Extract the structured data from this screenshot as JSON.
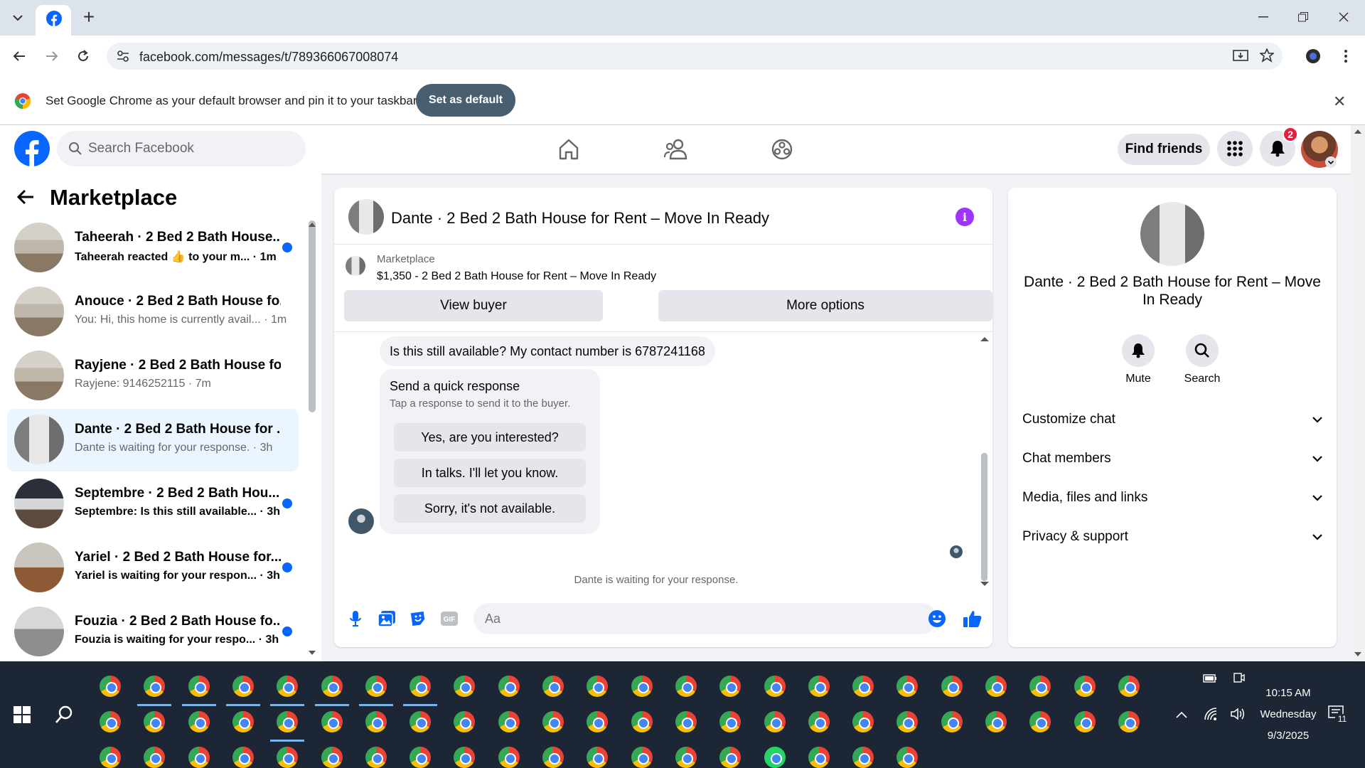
{
  "browser": {
    "url": "facebook.com/messages/t/789366067008074",
    "infobar_text": "Set Google Chrome as your default browser and pin it to your taskbar",
    "infobar_button": "Set as default"
  },
  "header": {
    "search_placeholder": "Search Facebook",
    "find_friends": "Find friends",
    "notification_count": "2"
  },
  "sidebar": {
    "title": "Marketplace",
    "conversations": [
      {
        "title": "Taheerah · 2 Bed 2 Bath House...",
        "subtitle": "Taheerah reacted 👍 to your m... · 1m",
        "unread": true,
        "thumb": "t-room"
      },
      {
        "title": "Anouce · 2 Bed 2 Bath House fo...",
        "subtitle": "You: Hi, this home is currently avail... · 1m",
        "unread": false,
        "thumb": "t-room"
      },
      {
        "title": "Rayjene · 2 Bed 2 Bath House fo...",
        "subtitle": "Rayjene: 9146252115 · 7m",
        "unread": false,
        "thumb": "t-room"
      },
      {
        "title": "Dante · 2 Bed 2 Bath House for ...",
        "subtitle": "Dante is waiting for your response. · 3h",
        "unread": false,
        "selected": true,
        "thumb": "t-hall"
      },
      {
        "title": "Septembre · 2 Bed 2 Bath Hou...",
        "subtitle": "Septembre: Is this still available... · 3h",
        "unread": true,
        "thumb": "t-dark"
      },
      {
        "title": "Yariel · 2 Bed 2 Bath House for...",
        "subtitle": "Yariel is waiting for your respon... · 3h",
        "unread": true,
        "thumb": "t-wood"
      },
      {
        "title": "Fouzia · 2 Bed 2 Bath House fo...",
        "subtitle": "Fouzia is waiting for your respo... · 3h",
        "unread": true,
        "thumb": "t-grey"
      }
    ]
  },
  "chat": {
    "title": "Dante · 2 Bed 2 Bath House for Rent – Move In Ready",
    "listing_label": "Marketplace",
    "listing": "$1,350 - 2 Bed 2 Bath House for Rent – Move In Ready",
    "view_buyer": "View buyer",
    "more_options": "More options",
    "message": "Is this still available? My contact number is 6787241168",
    "quick_title": "Send a quick response",
    "quick_sub": "Tap a response to send it to the buyer.",
    "quick_replies": [
      "Yes, are you interested?",
      "In talks. I'll let you know.",
      "Sorry, it's not available."
    ],
    "waiting": "Dante is waiting for your response.",
    "input_placeholder": "Aa"
  },
  "details": {
    "title": "Dante · 2 Bed 2 Bath House for Rent – Move In Ready",
    "mute": "Mute",
    "search": "Search",
    "sections": [
      "Customize chat",
      "Chat members",
      "Media, files and links",
      "Privacy & support"
    ]
  },
  "taskbar": {
    "time": "10:15 AM",
    "day": "Wednesday",
    "date": "9/3/2025",
    "notification_count": "11"
  },
  "colors": {
    "fb_blue": "#0866ff",
    "badge_red": "#e41e3f",
    "info_purple": "#a033ff"
  }
}
